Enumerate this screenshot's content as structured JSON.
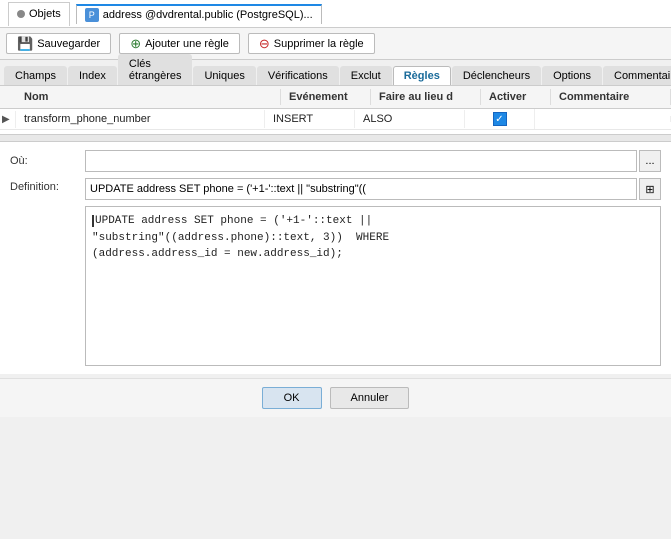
{
  "titlebar": {
    "objects_label": "Objets",
    "tab_label": "address @dvdrental.public (PostgreSQL)..."
  },
  "toolbar": {
    "save_label": "Sauvegarder",
    "add_label": "Ajouter une règle",
    "delete_label": "Supprimer la règle",
    "save_icon": "💾",
    "add_icon": "＋",
    "delete_icon": "－"
  },
  "nav_tabs": [
    {
      "id": "champs",
      "label": "Champs"
    },
    {
      "id": "index",
      "label": "Index"
    },
    {
      "id": "cles",
      "label": "Clés étrangères"
    },
    {
      "id": "uniques",
      "label": "Uniques"
    },
    {
      "id": "verifications",
      "label": "Vérifications"
    },
    {
      "id": "exclut",
      "label": "Exclut"
    },
    {
      "id": "regles",
      "label": "Règles",
      "active": true
    },
    {
      "id": "declencheurs",
      "label": "Déclencheurs"
    },
    {
      "id": "options",
      "label": "Options"
    },
    {
      "id": "commentaire",
      "label": "Commentaire"
    }
  ],
  "table": {
    "headers": {
      "nom": "Nom",
      "evenement": "Evénement",
      "faire_au_lieu": "Faire au lieu d",
      "activer": "Activer",
      "commentaire": "Commentaire"
    },
    "rows": [
      {
        "nom": "transform_phone_number",
        "evenement": "INSERT",
        "faire_au_lieu": "ALSO",
        "activer": true,
        "commentaire": ""
      }
    ]
  },
  "form": {
    "ou_label": "Où:",
    "ou_value": "",
    "ou_placeholder": "",
    "definition_label": "Definition:",
    "definition_short": "UPDATE address SET phone = ('+1-'::text || \"substring\"((",
    "definition_full": "|UPDATE address SET phone = ('+1-'::text ||\n\"substring\"((address.phone)::text, 3))  WHERE\n(address.address_id = new.address_id);",
    "dots_btn": "...",
    "expand_btn": "⊞"
  },
  "footer": {
    "ok_label": "OK",
    "cancel_label": "Annuler"
  }
}
